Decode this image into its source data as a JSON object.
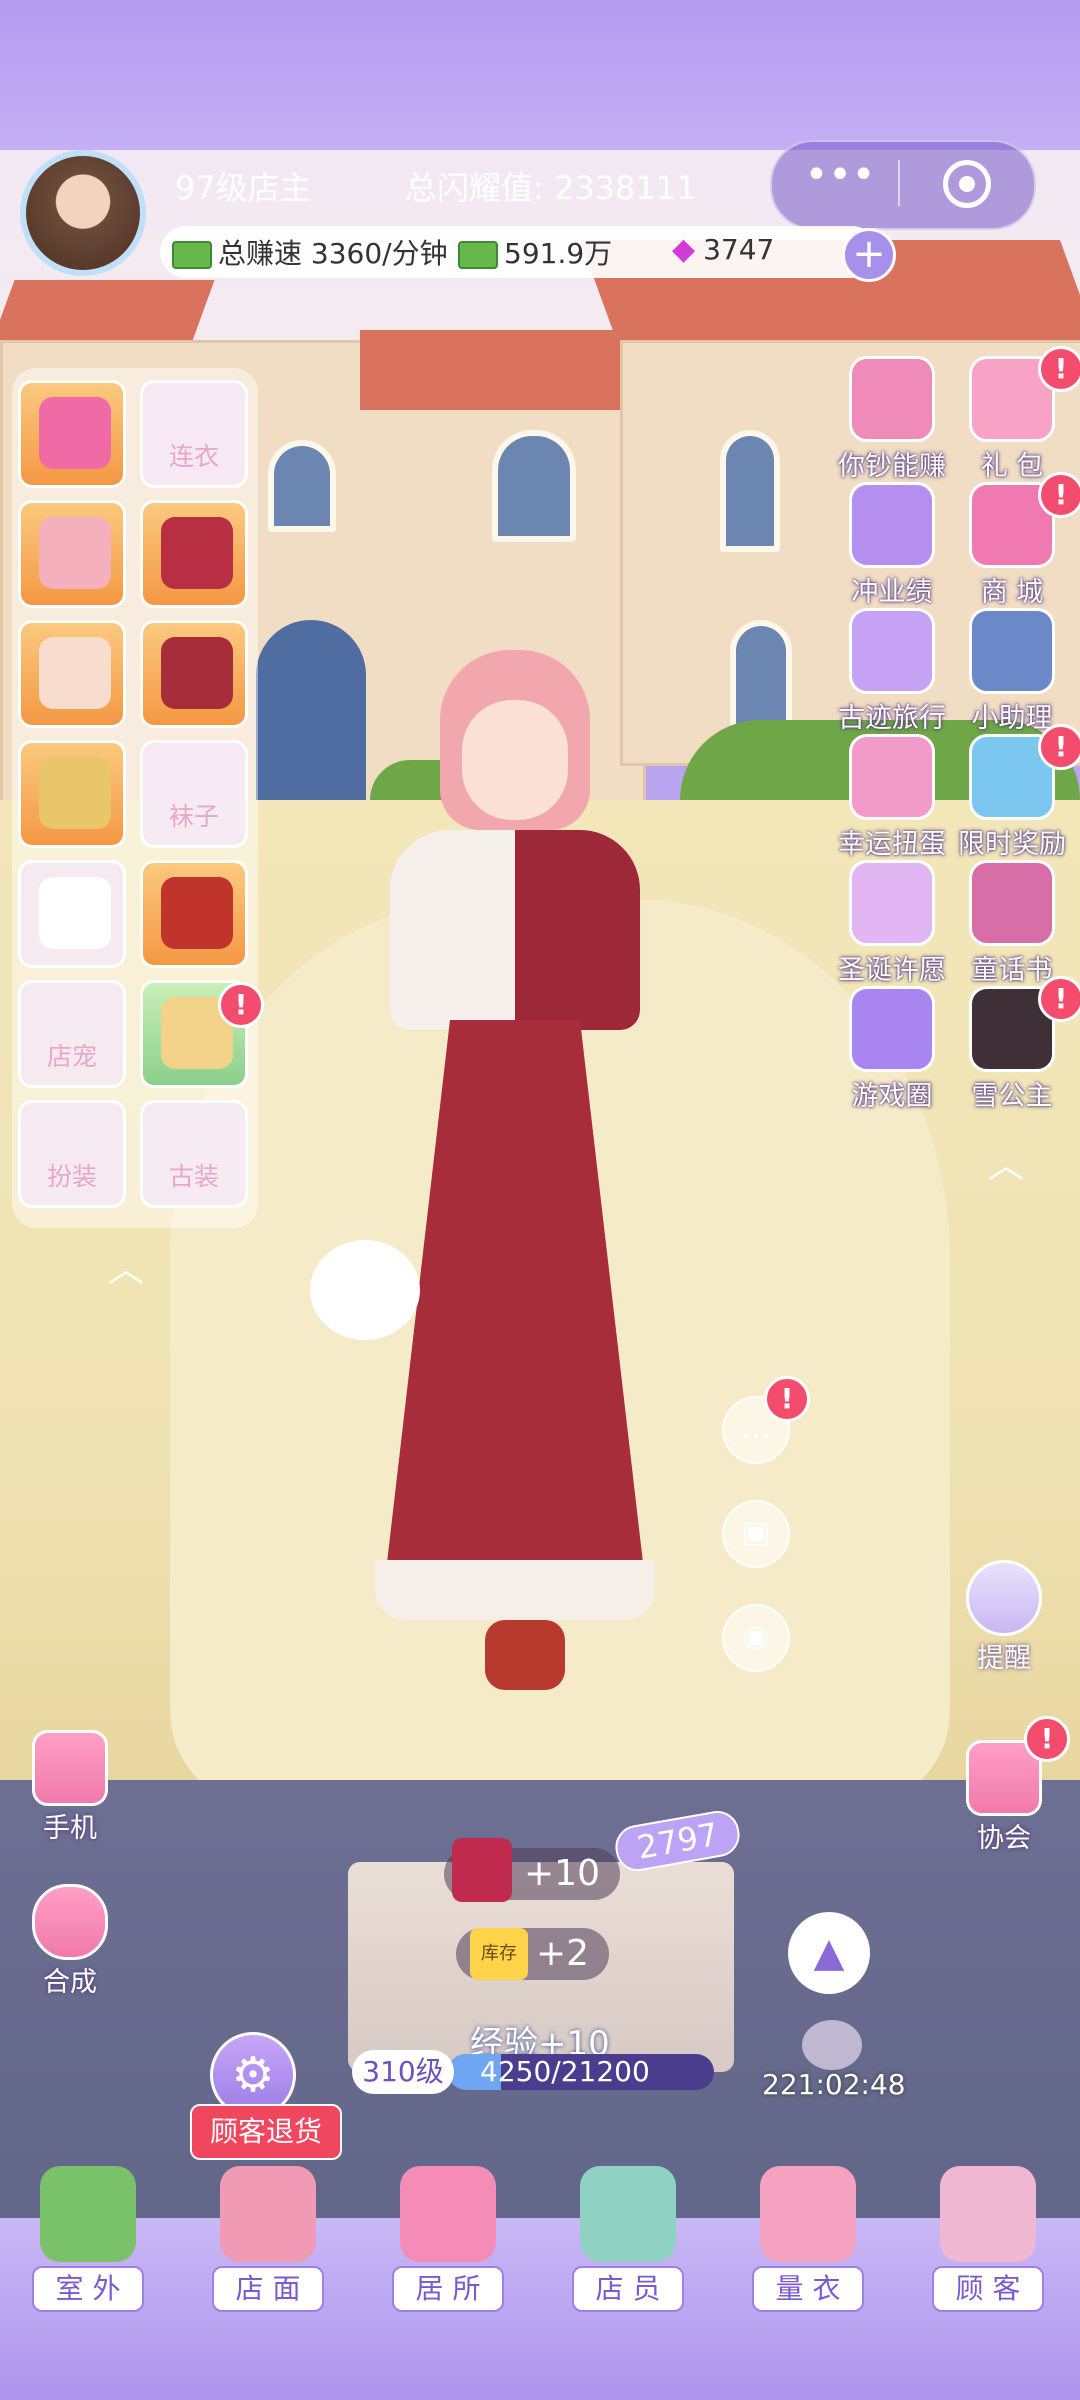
{
  "player": {
    "level_title": "97级店主",
    "glory_label": "总闪耀值: 2338111"
  },
  "resources": {
    "speed": "总赚速 3360/分钟",
    "cash": "591.9万",
    "gems": "3747",
    "add": "+"
  },
  "capsule": {
    "more": "•••"
  },
  "wardrobe": {
    "slots": [
      {
        "label": ""
      },
      {
        "label": "连衣"
      },
      {
        "label": ""
      },
      {
        "label": ""
      },
      {
        "label": ""
      },
      {
        "label": ""
      },
      {
        "label": ""
      },
      {
        "label": "袜子"
      },
      {
        "label": ""
      },
      {
        "label": ""
      },
      {
        "label": "店宠"
      },
      {
        "label": ""
      },
      {
        "label": "扮装"
      },
      {
        "label": "古装"
      }
    ],
    "badge": "!"
  },
  "right_menu": [
    {
      "label": "你钞能赚",
      "icon": "money-icon"
    },
    {
      "label": "礼 包",
      "icon": "gift-icon"
    },
    {
      "label": "冲业绩",
      "icon": "chart-icon"
    },
    {
      "label": "商 城",
      "icon": "shop-icon"
    },
    {
      "label": "古迹旅行",
      "icon": "bus-icon"
    },
    {
      "label": "小助理",
      "icon": "assistant-icon"
    },
    {
      "label": "幸运扭蛋",
      "icon": "gacha-icon"
    },
    {
      "label": "限时奖励",
      "icon": "reward-icon"
    },
    {
      "label": "圣诞许愿",
      "icon": "tree-icon"
    },
    {
      "label": "童话书",
      "icon": "book-icon"
    },
    {
      "label": "游戏圈",
      "icon": "gamepad-icon"
    },
    {
      "label": "雪公主",
      "icon": "princess-icon"
    }
  ],
  "side": {
    "remind": "提醒",
    "guild": "协会",
    "phone": "手机",
    "compose": "合成"
  },
  "box": {
    "dress_gain": "+10",
    "stock_gain": "+2",
    "stock_tag": "库存",
    "tag": "2797"
  },
  "exp": {
    "label": "经验+10",
    "level": "310级",
    "progress": "4250/21200",
    "fraction": 0.2005
  },
  "timer": "221:02:48",
  "refund": "顾客退货",
  "nav": [
    {
      "label": "室 外"
    },
    {
      "label": "店 面"
    },
    {
      "label": "居 所"
    },
    {
      "label": "店 员"
    },
    {
      "label": "量 衣"
    },
    {
      "label": "顾 客"
    }
  ],
  "colors": {
    "accent": "#b59af0",
    "badge": "#f34c6c",
    "dress": "#a72d3a"
  }
}
